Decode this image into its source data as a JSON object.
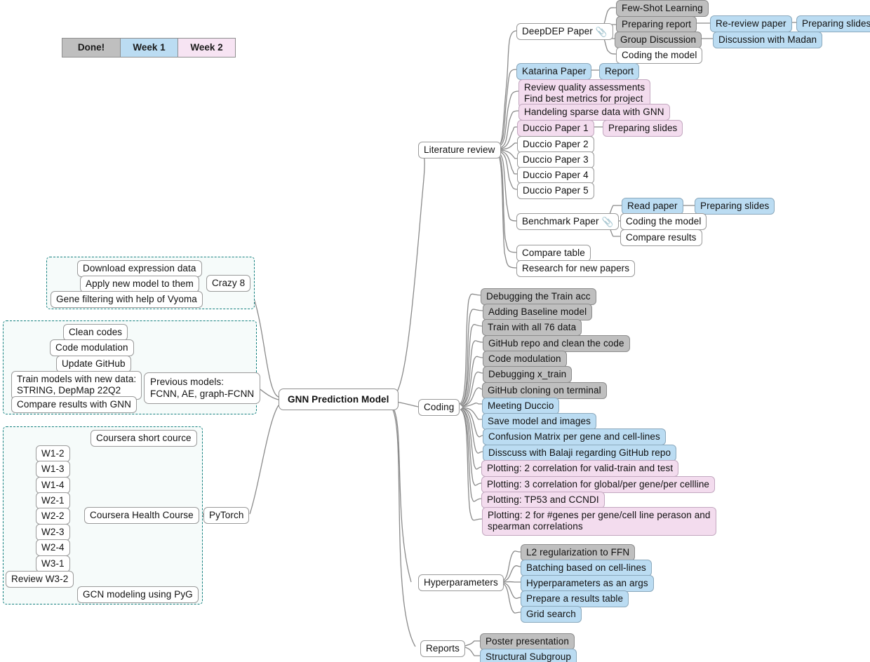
{
  "legend": {
    "items": [
      {
        "label": "Done!",
        "color": "#bfbfbf",
        "key": "done"
      },
      {
        "label": "Week 1",
        "color": "#bbdcf2",
        "key": "week1"
      },
      {
        "label": "Week 2",
        "color": "#f7e4f3",
        "key": "week2"
      }
    ]
  },
  "root": {
    "label": "GNN Prediction Model"
  },
  "branches": {
    "literature_review": {
      "label": "Literature review",
      "children": [
        {
          "label": "DeepDEP Paper",
          "state": "none",
          "attachment": true,
          "children": [
            {
              "label": "Few-Shot Learning",
              "state": "done"
            },
            {
              "label": "Preparing report",
              "state": "done",
              "children": [
                {
                  "label": "Re-review paper",
                  "state": "week1",
                  "children": [
                    {
                      "label": "Preparing slides",
                      "state": "week1"
                    }
                  ]
                }
              ]
            },
            {
              "label": "Group Discussion",
              "state": "done",
              "children": [
                {
                  "label": "Discussion with Madan",
                  "state": "week1"
                }
              ]
            },
            {
              "label": "Coding the model",
              "state": "none"
            }
          ]
        },
        {
          "label": "Katarina Paper",
          "state": "week1",
          "children": [
            {
              "label": "Report",
              "state": "week1"
            }
          ]
        },
        {
          "label": "Review quality assessments\nFind best metrics for project",
          "state": "week2"
        },
        {
          "label": "Handeling sparse data with GNN",
          "state": "week2"
        },
        {
          "label": "Duccio Paper 1",
          "state": "week2",
          "children": [
            {
              "label": "Preparing slides",
              "state": "week2"
            }
          ]
        },
        {
          "label": "Duccio Paper 2",
          "state": "none"
        },
        {
          "label": "Duccio Paper 3",
          "state": "none"
        },
        {
          "label": "Duccio Paper 4",
          "state": "none"
        },
        {
          "label": "Duccio Paper 5",
          "state": "none"
        },
        {
          "label": "Benchmark Paper",
          "state": "none",
          "attachment": true,
          "children": [
            {
              "label": "Read paper",
              "state": "week1",
              "children": [
                {
                  "label": "Preparing slides",
                  "state": "week1"
                }
              ]
            },
            {
              "label": "Coding the model",
              "state": "none"
            },
            {
              "label": "Compare results",
              "state": "none"
            }
          ]
        },
        {
          "label": "Compare table",
          "state": "none"
        },
        {
          "label": "Research for new papers",
          "state": "none"
        }
      ]
    },
    "coding": {
      "label": "Coding",
      "children": [
        {
          "label": "Debugging the Train acc",
          "state": "done"
        },
        {
          "label": "Adding Baseline model",
          "state": "done"
        },
        {
          "label": "Train with all 76 data",
          "state": "done"
        },
        {
          "label": "GitHub repo and clean the code",
          "state": "done"
        },
        {
          "label": "Code modulation",
          "state": "done"
        },
        {
          "label": "Debugging x_train",
          "state": "done"
        },
        {
          "label": "GitHub cloning on terminal",
          "state": "done"
        },
        {
          "label": "Meeting Duccio",
          "state": "week1"
        },
        {
          "label": "Save model and images",
          "state": "week1"
        },
        {
          "label": "Confusion Matrix per gene and cell-lines",
          "state": "week1"
        },
        {
          "label": "Disscuss with Balaji regarding GitHub repo",
          "state": "week1"
        },
        {
          "label": "Plotting: 2 correlation for valid-train and test",
          "state": "week2"
        },
        {
          "label": "Plotting: 3 correlation for global/per gene/per cellline",
          "state": "week2"
        },
        {
          "label": "Plotting: TP53 and CCNDI",
          "state": "week2"
        },
        {
          "label": "Plotting: 2 for #genes per gene/cell line perason and\nspearman correlations",
          "state": "week2"
        }
      ]
    },
    "hyperparameters": {
      "label": "Hyperparameters",
      "children": [
        {
          "label": "L2 regularization to FFN",
          "state": "done"
        },
        {
          "label": "Batching based on cell-lines",
          "state": "week1"
        },
        {
          "label": "Hyperparameters as an args",
          "state": "week1"
        },
        {
          "label": "Prepare a results table",
          "state": "week1"
        },
        {
          "label": "Grid search",
          "state": "week1"
        }
      ]
    },
    "reports": {
      "label": "Reports",
      "children": [
        {
          "label": "Poster presentation",
          "state": "done"
        },
        {
          "label": "Structural Subgroup",
          "state": "week1"
        }
      ]
    },
    "crazy8": {
      "label": "Crazy 8",
      "children": [
        {
          "label": "Download expression data",
          "state": "none"
        },
        {
          "label": "Apply new model to them",
          "state": "none"
        },
        {
          "label": "Gene filtering with help of Vyoma",
          "state": "none"
        }
      ]
    },
    "previous_models": {
      "label": "Previous models:\nFCNN, AE, graph-FCNN",
      "children": [
        {
          "label": "Clean codes",
          "state": "none"
        },
        {
          "label": "Code modulation",
          "state": "none"
        },
        {
          "label": "Update GitHub",
          "state": "none"
        },
        {
          "label": "Train models with new data:\nSTRING, DepMap 22Q2",
          "state": "none"
        },
        {
          "label": "Compare results with GNN",
          "state": "none"
        }
      ]
    },
    "pytorch": {
      "label": "PyTorch",
      "children": [
        {
          "label": "Coursera short cource",
          "state": "none"
        },
        {
          "label": "Coursera Health Course",
          "state": "none",
          "children": [
            {
              "label": "W1-2",
              "state": "none"
            },
            {
              "label": "W1-3",
              "state": "none"
            },
            {
              "label": "W1-4",
              "state": "none"
            },
            {
              "label": "W2-1",
              "state": "none"
            },
            {
              "label": "W2-2",
              "state": "none"
            },
            {
              "label": "W2-3",
              "state": "none"
            },
            {
              "label": "W2-4",
              "state": "none"
            },
            {
              "label": "W3-1",
              "state": "none"
            },
            {
              "label": "Review W3-2",
              "state": "none"
            }
          ]
        },
        {
          "label": "GCN modeling using PyG",
          "state": "none"
        }
      ]
    }
  },
  "colors": {
    "done": "#bfbfbf",
    "week1": "#bbdcf2",
    "week2": "#f3dcee",
    "none": "#ffffff",
    "edge": "#8a8a8a",
    "group_border": "#13807f",
    "group_fill": "#f6fbfa"
  }
}
